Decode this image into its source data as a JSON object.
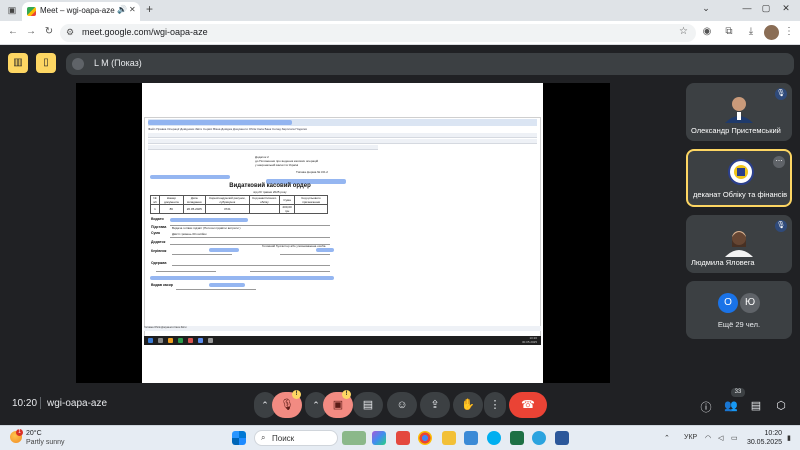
{
  "browser": {
    "tab_title": "Meet – wgi-oapa-aze",
    "url": "meet.google.com/wgi-oapa-aze",
    "new_tab_label": "+",
    "win_controls": [
      "⌄",
      "—",
      "▢",
      "✕"
    ]
  },
  "meet": {
    "presenter_label": "L M (Показ)",
    "meeting_time": "10:20",
    "meeting_code": "wgi-oapa-aze",
    "people_count": "33",
    "colors": {
      "accent_yellow": "#fdd663",
      "leave_red": "#ea4335",
      "muted_red": "#f28b82",
      "panel": "#3c4043"
    }
  },
  "participants": [
    {
      "name": "Олександр Пристемський",
      "muted": true,
      "icon": "mic-off-icon"
    },
    {
      "name": "деканат Обліку та фінансів",
      "muted": false,
      "icon": "speaking-icon"
    },
    {
      "name": "Людмила Яловега",
      "muted": true,
      "icon": "mic-off-icon"
    }
  ],
  "more_participants": {
    "avatars": [
      "О",
      "Ю"
    ],
    "label": "Ещё 29 чел."
  },
  "shared_doc": {
    "header_lines": [
      "Додаток 2",
      "до Положення про ведення касових операцій",
      "у національній валюті в Україні"
    ],
    "form_ref": "Типова форма № КО-2",
    "title": "Видатковий касовий ордер",
    "date_line": "від 20 травня 2025 року",
    "table_headers": [
      "№ з/п",
      "Номер документа",
      "Дата складання",
      "Кореспондуючий рахунок, субрахунок",
      "Код аналітичного обліку",
      "Сума",
      "Код цільового призначення"
    ],
    "table_row": [
      "1",
      "86",
      "20.05.2025",
      "3721",
      "",
      "200,00 грн",
      ""
    ],
    "labels": [
      "Видати",
      "Підстава",
      "Сума",
      "Додаток",
      "Керівник",
      "Одержав"
    ],
    "suma_text": "Двісті гривень 00 копійок",
    "pidstava_text": "Видача готівки підзвіт (Поточні підзвітні витрати )",
    "signature_caption": "Головний бухгалтер або уповноважена особа",
    "bottom_text": "Видав касир",
    "sheet_tabs": "Головна  Облік  Документи  Каса  Звіти"
  },
  "taskbar": {
    "temperature": "20°C",
    "weather": "Partly sunny",
    "weather_badge": "1",
    "search_label": "Поиск",
    "language": "УКР",
    "time": "10:20",
    "date": "30.05.2025"
  }
}
